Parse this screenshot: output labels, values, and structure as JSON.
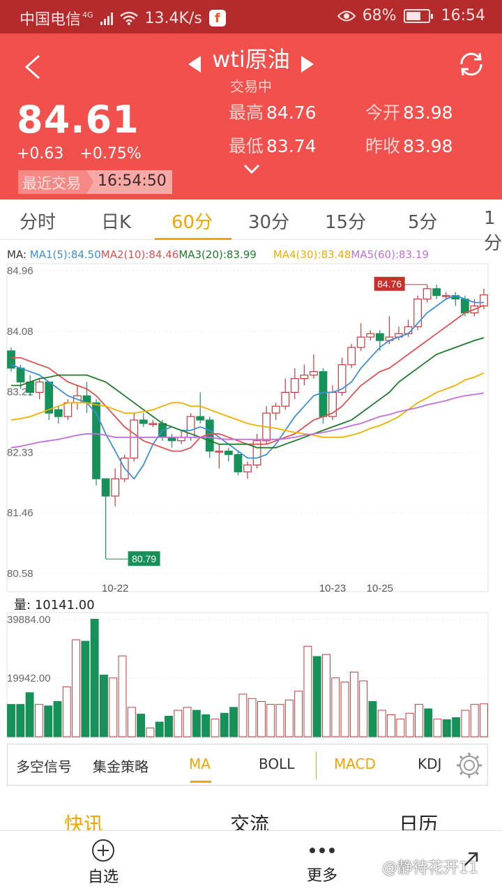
{
  "status_bar": {
    "carrier": "中国电信",
    "network": "4G",
    "speed": "13.4K/s",
    "battery": "68%",
    "battery_level": 0.68,
    "time": "16:54",
    "icons": [
      "signal-icon",
      "wifi-icon",
      "app-notification-icon",
      "eye-icon",
      "battery-icon"
    ]
  },
  "header": {
    "title": "wti原油",
    "status": "交易中",
    "price": "84.61",
    "change": "+0.63",
    "change_pct": "+0.75%",
    "last_trade_label": "最近交易",
    "last_trade_time": "16:54:50",
    "stats": {
      "high_label": "最高",
      "high": "84.76",
      "open_label": "今开",
      "open": "83.98",
      "low_label": "最低",
      "low": "83.74",
      "prev_close_label": "昨收",
      "prev_close": "83.98"
    },
    "bg_color": "#f2504c"
  },
  "period_tabs": [
    "分时",
    "日K",
    "60分",
    "30分",
    "15分",
    "5分",
    "1分"
  ],
  "active_period": "60分",
  "ma_legend": {
    "prefix": "MA: ",
    "items": [
      {
        "label": "MA1(5):84.50",
        "color": "#3d8fd6"
      },
      {
        "label": "MA2(10):84.46",
        "color": "#e05050"
      },
      {
        "label": "MA3(20):83.99",
        "color": "#1f7a2a"
      },
      {
        "label": "MA4(30):83.48",
        "color": "#f0b000"
      },
      {
        "label": "MA5(60):83.19",
        "color": "#c070d8"
      }
    ]
  },
  "volume": {
    "label": "量:",
    "value": "10141.00"
  },
  "chart_data": {
    "type": "candlestick",
    "y_ticks": [
      "84.96",
      "84.08",
      "83.21",
      "82.33",
      "81.46",
      "80.58"
    ],
    "ylim": [
      80.58,
      84.96
    ],
    "x_labels": [
      {
        "index": 11,
        "label": "10-22"
      },
      {
        "index": 34,
        "label": "10-23"
      },
      {
        "index": 39,
        "label": "10-25"
      }
    ],
    "max_marker": "84.76",
    "min_marker": "80.79",
    "candles": [
      [
        83.8,
        83.55,
        83.85,
        83.5
      ],
      [
        83.55,
        83.35,
        83.6,
        83.25
      ],
      [
        83.35,
        83.2,
        83.45,
        83.15
      ],
      [
        83.2,
        83.35,
        83.4,
        83.1
      ],
      [
        83.35,
        82.9,
        83.35,
        82.8
      ],
      [
        82.95,
        82.85,
        83.0,
        82.75
      ],
      [
        82.85,
        83.05,
        83.1,
        82.8
      ],
      [
        83.05,
        83.15,
        83.3,
        82.95
      ],
      [
        83.15,
        83.05,
        83.35,
        82.9
      ],
      [
        83.05,
        81.95,
        83.1,
        81.85
      ],
      [
        81.95,
        81.7,
        81.95,
        80.79
      ],
      [
        81.7,
        81.95,
        82.1,
        81.55
      ],
      [
        81.95,
        82.25,
        82.3,
        81.9
      ],
      [
        82.25,
        82.8,
        82.9,
        82.2
      ],
      [
        82.8,
        82.75,
        82.9,
        82.7
      ],
      [
        82.75,
        82.75,
        82.8,
        82.7
      ],
      [
        82.75,
        82.55,
        82.8,
        82.5
      ],
      [
        82.55,
        82.5,
        82.6,
        82.4
      ],
      [
        82.5,
        82.55,
        82.65,
        82.45
      ],
      [
        82.55,
        82.85,
        82.9,
        82.5
      ],
      [
        82.85,
        82.8,
        83.2,
        82.75
      ],
      [
        82.8,
        82.35,
        82.85,
        82.25
      ],
      [
        82.35,
        82.35,
        82.45,
        82.1
      ],
      [
        82.35,
        82.3,
        82.4,
        82.2
      ],
      [
        82.3,
        82.05,
        82.35,
        82.0
      ],
      [
        82.05,
        82.15,
        82.2,
        81.95
      ],
      [
        82.15,
        82.5,
        82.6,
        82.1
      ],
      [
        82.5,
        82.9,
        83.0,
        82.45
      ],
      [
        82.9,
        83.0,
        83.05,
        82.8
      ],
      [
        83.0,
        83.2,
        83.4,
        82.95
      ],
      [
        83.2,
        83.4,
        83.55,
        83.1
      ],
      [
        83.4,
        83.45,
        83.6,
        83.3
      ],
      [
        83.45,
        83.5,
        83.75,
        83.4
      ],
      [
        83.5,
        82.85,
        83.55,
        82.75
      ],
      [
        82.85,
        83.2,
        83.3,
        82.8
      ],
      [
        83.2,
        83.6,
        83.7,
        83.15
      ],
      [
        83.6,
        83.85,
        83.9,
        83.55
      ],
      [
        83.85,
        84.0,
        84.2,
        83.8
      ],
      [
        84.0,
        84.05,
        84.1,
        83.95
      ],
      [
        84.05,
        83.95,
        84.1,
        83.8
      ],
      [
        83.95,
        84.0,
        84.3,
        83.9
      ],
      [
        84.0,
        84.05,
        84.15,
        83.95
      ],
      [
        84.05,
        84.15,
        84.25,
        84.0
      ],
      [
        84.15,
        84.55,
        84.6,
        84.1
      ],
      [
        84.55,
        84.7,
        84.76,
        84.5
      ],
      [
        84.7,
        84.6,
        84.76,
        84.55
      ],
      [
        84.6,
        84.6,
        84.65,
        84.55
      ],
      [
        84.6,
        84.55,
        84.65,
        84.45
      ],
      [
        84.55,
        84.35,
        84.6,
        84.3
      ],
      [
        84.35,
        84.45,
        84.55,
        84.3
      ],
      [
        84.45,
        84.61,
        84.7,
        84.4
      ]
    ],
    "ma_series": [
      {
        "name": "MA1",
        "color": "#3d8fd6",
        "values": [
          83.6,
          83.55,
          83.5,
          83.45,
          83.35,
          83.25,
          83.15,
          83.1,
          83.05,
          82.9,
          82.6,
          82.35,
          82.1,
          81.95,
          82.15,
          82.45,
          82.65,
          82.7,
          82.65,
          82.65,
          82.7,
          82.65,
          82.55,
          82.45,
          82.35,
          82.25,
          82.25,
          82.3,
          82.45,
          82.65,
          82.85,
          83.0,
          83.15,
          83.2,
          83.2,
          83.25,
          83.35,
          83.55,
          83.7,
          83.85,
          83.95,
          84.0,
          84.05,
          84.2,
          84.35,
          84.45,
          84.55,
          84.6,
          84.55,
          84.5,
          84.5
        ]
      },
      {
        "name": "MA2",
        "color": "#e05050",
        "values": [
          83.7,
          83.7,
          83.65,
          83.6,
          83.55,
          83.45,
          83.35,
          83.3,
          83.25,
          83.15,
          83.0,
          82.85,
          82.7,
          82.6,
          82.5,
          82.45,
          82.4,
          82.35,
          82.35,
          82.4,
          82.55,
          82.6,
          82.6,
          82.55,
          82.5,
          82.45,
          82.45,
          82.45,
          82.5,
          82.55,
          82.6,
          82.7,
          82.8,
          82.85,
          82.9,
          83.0,
          83.15,
          83.3,
          83.4,
          83.5,
          83.55,
          83.65,
          83.75,
          83.85,
          83.95,
          84.05,
          84.15,
          84.25,
          84.35,
          84.4,
          84.46
        ]
      },
      {
        "name": "MA3",
        "color": "#1f7a2a",
        "values": [
          83.3,
          83.3,
          83.35,
          83.4,
          83.42,
          83.45,
          83.45,
          83.45,
          83.45,
          83.4,
          83.35,
          83.25,
          83.15,
          83.05,
          82.95,
          82.85,
          82.75,
          82.7,
          82.65,
          82.6,
          82.55,
          82.5,
          82.45,
          82.45,
          82.45,
          82.45,
          82.4,
          82.4,
          82.4,
          82.45,
          82.5,
          82.55,
          82.6,
          82.65,
          82.7,
          82.75,
          82.8,
          82.9,
          83.0,
          83.1,
          83.2,
          83.35,
          83.45,
          83.55,
          83.65,
          83.75,
          83.8,
          83.85,
          83.9,
          83.95,
          83.99
        ]
      },
      {
        "name": "MA4",
        "color": "#f0b000",
        "values": [
          82.8,
          82.82,
          82.85,
          82.9,
          82.95,
          83.0,
          83.05,
          83.05,
          83.05,
          83.02,
          83.0,
          82.95,
          82.9,
          82.9,
          82.92,
          82.95,
          83.0,
          83.05,
          83.05,
          83.0,
          83.0,
          82.95,
          82.9,
          82.85,
          82.8,
          82.75,
          82.72,
          82.7,
          82.68,
          82.65,
          82.62,
          82.6,
          82.58,
          82.55,
          82.55,
          82.55,
          82.58,
          82.62,
          82.68,
          82.72,
          82.78,
          82.85,
          82.95,
          83.05,
          83.12,
          83.2,
          83.25,
          83.3,
          83.38,
          83.42,
          83.48
        ]
      },
      {
        "name": "MA5",
        "color": "#c070d8",
        "values": [
          82.4,
          82.42,
          82.45,
          82.48,
          82.5,
          82.52,
          82.55,
          82.58,
          82.6,
          82.6,
          82.58,
          82.55,
          82.55,
          82.55,
          82.55,
          82.55,
          82.55,
          82.55,
          82.55,
          82.55,
          82.55,
          82.55,
          82.53,
          82.52,
          82.52,
          82.52,
          82.52,
          82.52,
          82.52,
          82.53,
          82.55,
          82.58,
          82.6,
          82.62,
          82.65,
          82.68,
          82.72,
          82.75,
          82.8,
          82.85,
          82.88,
          82.92,
          82.95,
          82.98,
          83.02,
          83.05,
          83.08,
          83.12,
          83.15,
          83.17,
          83.19
        ]
      }
    ],
    "volume_ticks": [
      "39884.00",
      "19942.00"
    ],
    "volume_max": 39884,
    "volumes": [
      11000,
      11000,
      15000,
      11000,
      10500,
      12000,
      17000,
      33000,
      32500,
      40000,
      21000,
      20000,
      27500,
      10000,
      7700,
      3000,
      5000,
      7000,
      9000,
      10000,
      9000,
      7500,
      6000,
      8000,
      10000,
      14500,
      13000,
      12000,
      11000,
      11000,
      12500,
      15500,
      30800,
      27300,
      28000,
      20000,
      18600,
      22000,
      19000,
      12000,
      9000,
      7500,
      6000,
      8000,
      11000,
      9500,
      6000,
      5800,
      6500,
      9000,
      11000,
      11200
    ]
  },
  "indicators": [
    "多空信号",
    "集金策略",
    "MA",
    "BOLL",
    "MACD",
    "KDJ"
  ],
  "news_tabs": [
    "快讯",
    "交流",
    "日历"
  ],
  "bottom_nav": {
    "watchlist": "自选",
    "more": "更多",
    "watermark": "@静待花开11"
  }
}
